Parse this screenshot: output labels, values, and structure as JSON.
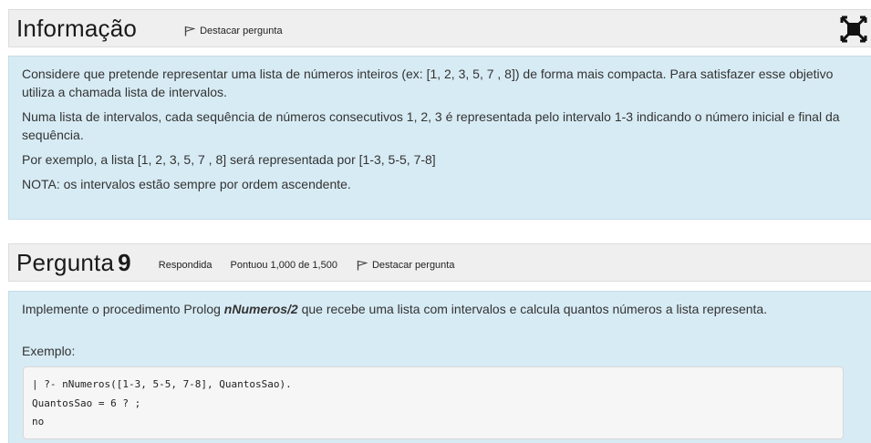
{
  "info": {
    "title": "Informação",
    "flag_label": "Destacar pergunta",
    "paragraphs": [
      "Considere que pretende representar uma lista de números inteiros (ex: [1, 2, 3, 5, 7 , 8]) de forma mais compacta. Para satisfazer esse objetivo utiliza a chamada lista de intervalos.",
      "Numa lista de intervalos, cada sequência de números consecutivos 1, 2, 3 é representada pelo intervalo 1-3 indicando o número inicial e final da sequência.",
      "Por exemplo, a lista [1, 2, 3, 5, 7 , 8] será representada por [1-3, 5-5, 7-8]",
      "NOTA: os intervalos estão sempre por ordem ascendente."
    ]
  },
  "question": {
    "title_word": "Pergunta",
    "number": "9",
    "status": "Respondida",
    "grade": "Pontuou 1,000 de 1,500",
    "flag_label": "Destacar pergunta",
    "text_before": "Implemente o procedimento Prolog ",
    "predicate": "nNumeros/2",
    "text_after": " que recebe uma lista com intervalos e calcula quantos números a lista representa.",
    "example_label": "Exemplo:",
    "code_lines": [
      "| ?- nNumeros([1-3, 5-5, 7-8], QuantosSao).",
      "QuantosSao = 6 ? ;",
      "no"
    ]
  },
  "icons": {
    "fullscreen": "fullscreen-toggle-icon",
    "flag": "flag-icon"
  },
  "colors": {
    "content_bg": "#d7ebf4",
    "header_bg": "#efefef"
  }
}
